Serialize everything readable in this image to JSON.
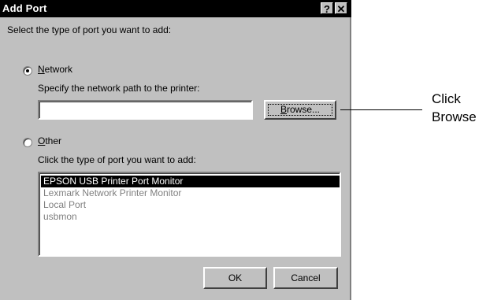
{
  "dialog": {
    "title": "Add Port",
    "help_glyph": "?",
    "close_glyph": "✕",
    "intro": "Select the type of port you want to add:",
    "network": {
      "label_u": "N",
      "label_rest": "etwork",
      "selected": true,
      "path_prompt": "Specify the network path to the printer:",
      "path_value": "",
      "browse_u": "B",
      "browse_rest": "rowse..."
    },
    "other": {
      "label_u": "O",
      "label_rest": "ther",
      "selected": false,
      "list_prompt": "Click the type of port you want to add:",
      "items": [
        "EPSON USB Printer Port Monitor",
        "Lexmark Network Printer Monitor",
        "Local Port",
        "usbmon"
      ],
      "selected_index": 0
    },
    "ok_label": "OK",
    "cancel_label": "Cancel"
  },
  "callout": {
    "line1": "Click",
    "line2": "Browse"
  }
}
